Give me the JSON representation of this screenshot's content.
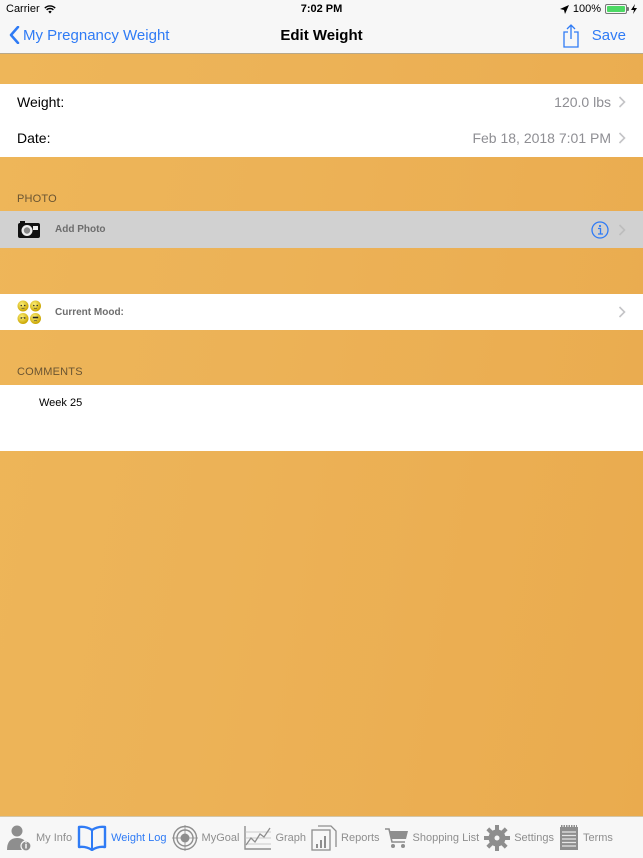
{
  "status_bar": {
    "carrier": "Carrier",
    "time": "7:02 PM",
    "battery": "100%",
    "battery_level_percent": 100
  },
  "nav": {
    "back_label": "My Pregnancy Weight",
    "title": "Edit Weight",
    "save_label": "Save",
    "accent_color": "#2f7bf5"
  },
  "details": {
    "weight_label": "Weight:",
    "weight_value": "120.0 lbs",
    "date_label": "Date:",
    "date_value": "Feb 18, 2018 7:01 PM"
  },
  "photo": {
    "section_header": "PHOTO",
    "add_photo_label": "Add Photo"
  },
  "mood": {
    "label": "Current Mood:"
  },
  "comments": {
    "section_header": "COMMENTS",
    "text": "Week 25"
  },
  "tab_bar": {
    "tabs": [
      {
        "label": "My Info",
        "icon": "person-info-icon",
        "active": false
      },
      {
        "label": "Weight Log",
        "icon": "open-book-icon",
        "active": true
      },
      {
        "label": "MyGoal",
        "icon": "target-icon",
        "active": false
      },
      {
        "label": "Graph",
        "icon": "line-graph-icon",
        "active": false
      },
      {
        "label": "Reports",
        "icon": "reports-icon",
        "active": false
      },
      {
        "label": "Shopping List",
        "icon": "shopping-cart-icon",
        "active": false
      },
      {
        "label": "Settings",
        "icon": "gear-icon",
        "active": false
      },
      {
        "label": "Terms",
        "icon": "notepad-icon",
        "active": false
      }
    ]
  },
  "theme": {
    "background": "#ebb054"
  }
}
